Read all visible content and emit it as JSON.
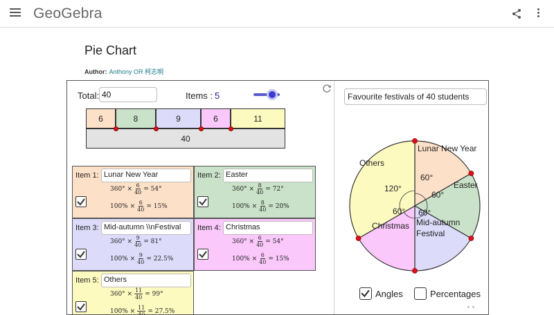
{
  "header": {
    "brand": "GeoGebra"
  },
  "page": {
    "title": "Pie Chart",
    "author_label": "Author:",
    "author_name": "Anthony OR 柯志明"
  },
  "controls": {
    "total_label": "Total:",
    "total_value": "40",
    "items_label": "Items :",
    "items_value": "5"
  },
  "bar": {
    "values": [
      "6",
      "8",
      "9",
      "6",
      "11"
    ],
    "total": "40"
  },
  "items": [
    {
      "label": "Item 1:",
      "name": "Lunar New Year",
      "num": "6",
      "den": "40",
      "deg": "= 54°",
      "pct": "= 15%"
    },
    {
      "label": "Item 2:",
      "name": "Easter",
      "num": "8",
      "den": "40",
      "deg": "= 72°",
      "pct": "= 20%"
    },
    {
      "label": "Item 3:",
      "name": "Mid-autumn \\\\nFestival",
      "num": "9",
      "den": "40",
      "deg": "= 81°",
      "pct": "= 22.5%"
    },
    {
      "label": "Item 4:",
      "name": "Christmas",
      "num": "6",
      "den": "40",
      "deg": "= 54°",
      "pct": "= 15%"
    },
    {
      "label": "Item 5:",
      "name": "Others",
      "num": "11",
      "den": "40",
      "deg": "= 99°",
      "pct": "= 27.5%"
    }
  ],
  "formula": {
    "deg_prefix": "360° ×",
    "pct_prefix": "100% ×"
  },
  "chart": {
    "title_input": "Favourite festivals of 40 students",
    "angles_label": "Angles",
    "percentages_label": "Percentages",
    "angles_checked": true,
    "percentages_checked": false
  },
  "chart_data": {
    "type": "pie",
    "title": "Favourite festivals of 40 students",
    "slices": [
      {
        "name": "Lunar New Year",
        "angle": 60,
        "label_lines": [
          "Lunar New Year"
        ],
        "color": "#fde0c8"
      },
      {
        "name": "Easter",
        "angle": 60,
        "label_lines": [
          "Easter"
        ],
        "color": "#c9e2c9"
      },
      {
        "name": "Mid-autumn Festival",
        "angle": 60,
        "label_lines": [
          "Mid-autumn",
          "Festival"
        ],
        "color": "#dcdcfa"
      },
      {
        "name": "Christmas",
        "angle": 60,
        "label_lines": [
          "Christmas"
        ],
        "color": "#fac8fa"
      },
      {
        "name": "Others",
        "angle": 120,
        "label_lines": [
          "Others"
        ],
        "color": "#fdfac0"
      }
    ],
    "angle_labels": [
      "60°",
      "60°",
      "60°",
      "60°",
      "120°"
    ]
  },
  "colors": {
    "item1": "#fde0c8",
    "item2": "#c9e2c9",
    "item3": "#dcdcfa",
    "item4": "#fac8fa",
    "item5": "#fdfac0",
    "total": "#e3e3e3",
    "marker": "#e0101a",
    "accent": "#3a3ad0"
  }
}
